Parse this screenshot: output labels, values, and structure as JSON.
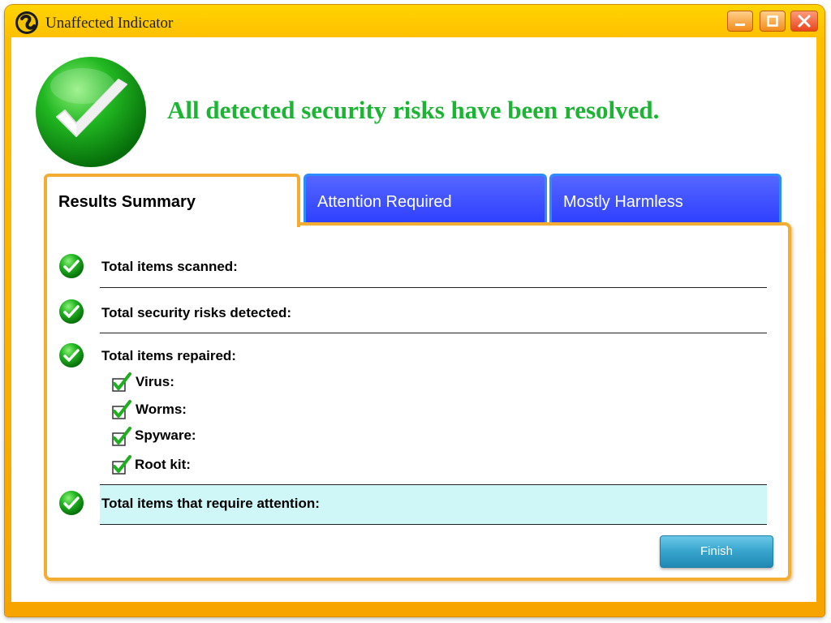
{
  "window": {
    "title": "Unaffected Indicator"
  },
  "header": {
    "headline": "All detected security risks have been resolved.",
    "icon": "green-checkmark-icon"
  },
  "tabs": [
    {
      "label": "Results Summary",
      "active": true
    },
    {
      "label": "Attention Required",
      "active": false
    },
    {
      "label": "Mostly Harmless",
      "active": false
    }
  ],
  "results": {
    "scanned_label": "Total items scanned:",
    "risks_label": "Total security risks detected:",
    "repaired_label": "Total items repaired:",
    "repaired_items": [
      {
        "label": "Virus:"
      },
      {
        "label": "Worms:"
      },
      {
        "label": "Spyware:"
      },
      {
        "label": "Root kit:"
      }
    ],
    "attention_label": "Total items that require attention:"
  },
  "buttons": {
    "finish": "Finish"
  },
  "colors": {
    "headline": "#1bb433",
    "frame": "#ffc000",
    "tab_blue": "#3344ff",
    "attention_row": "#cff7f7"
  }
}
